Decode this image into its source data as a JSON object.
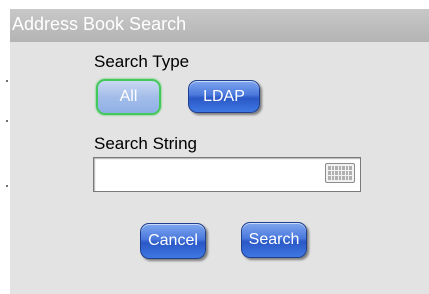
{
  "dialog": {
    "title": "Address Book Search"
  },
  "search_type": {
    "label": "Search Type",
    "options": [
      {
        "label": "All",
        "selected": true
      },
      {
        "label": "LDAP",
        "selected": false
      }
    ]
  },
  "search_string": {
    "label": "Search String",
    "value": "",
    "placeholder": ""
  },
  "actions": {
    "cancel_label": "Cancel",
    "search_label": "Search"
  },
  "colors": {
    "selection_border": "#43c85a",
    "button_blue": "#2a58c6",
    "panel_background": "#e3e3e3"
  },
  "icons": {
    "keyboard": "keyboard-icon"
  }
}
